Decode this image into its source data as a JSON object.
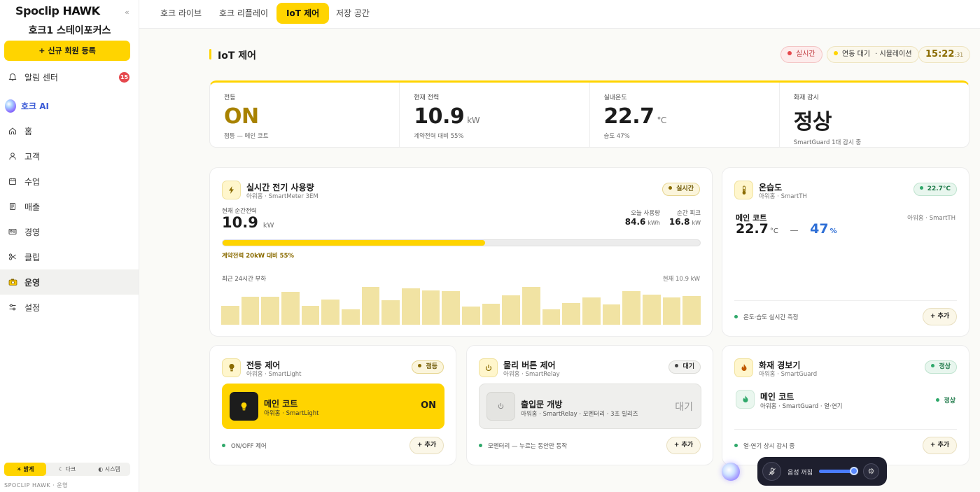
{
  "sidebar": {
    "logo_a": "Spoclip",
    "logo_b": "HAWK",
    "collapse": "«",
    "store": "호크1 스테이포커스",
    "new_member": "+ 신규 회원 등록",
    "items": [
      {
        "label": "알림 센터",
        "icon": "bell-icon",
        "badge": "15"
      },
      {
        "label": "호크 AI",
        "icon": "ai-orb-icon"
      },
      {
        "label": "홈",
        "icon": "home-icon"
      },
      {
        "label": "고객",
        "icon": "person-icon"
      },
      {
        "label": "수업",
        "icon": "calendar-icon"
      },
      {
        "label": "매출",
        "icon": "receipt-icon"
      },
      {
        "label": "경영",
        "icon": "id-card-icon"
      },
      {
        "label": "클립",
        "icon": "scissors-icon"
      },
      {
        "label": "운영",
        "icon": "camera-icon"
      },
      {
        "label": "설정",
        "icon": "sliders-icon"
      }
    ],
    "theme": {
      "light": "☀ 밝게",
      "dark": "☾ 다크",
      "system": "◐ 시스템"
    },
    "footer": "SPOCLIP HAWK · 운영"
  },
  "tabs": [
    "호크 라이브",
    "호크 리플레이",
    "IoT 제어",
    "저장 공간"
  ],
  "page": {
    "title": "IoT 제어",
    "status_live": "실시간",
    "status_sim_a": "연동 대기",
    "status_sim_b": "· 시뮬레이션",
    "clock_main": "15:22",
    "clock_sec": ":31"
  },
  "stats": [
    {
      "label": "전등",
      "value": "ON",
      "unit": "",
      "sub": "점등 — 메인 코트"
    },
    {
      "label": "현재 전력",
      "value": "10.9",
      "unit": "kW",
      "sub": "계약전력 대비 55%"
    },
    {
      "label": "실내온도",
      "value": "22.7",
      "unit": "°C",
      "sub": "습도 47%"
    },
    {
      "label": "화재 감시",
      "value": "정상",
      "unit": "",
      "sub": "SmartGuard 1대 감시 중"
    }
  ],
  "power": {
    "title": "실시간 전기 사용량",
    "sub": "아워홈 · SmartMeter 3EM",
    "badge": "실시간",
    "current_label": "현재 순간전력",
    "current_value": "10.9",
    "current_unit": "kW",
    "today_label": "오늘 사용량",
    "today_value": "84.6",
    "today_unit": "kWh",
    "peak_label": "순간 피크",
    "peak_value": "16.8",
    "peak_unit": "kW",
    "progress": 0.55,
    "progress_label": "계약전력 20kW 대비 55%",
    "chart_label": "최근 24시간 부하",
    "chart_now": "현재 10.9 kW",
    "hourly_load": [
      28,
      41,
      41,
      49,
      28,
      37,
      23,
      56,
      36,
      54,
      51,
      50,
      27,
      31,
      43,
      56,
      23,
      32,
      40,
      30,
      50,
      44,
      40,
      42
    ]
  },
  "climate": {
    "title": "온습도",
    "sub": "아워홈 · SmartTH",
    "badge": "22.7°C",
    "zone": "메인 코트",
    "device": "아워홈 · SmartTH",
    "temp": "22.7",
    "temp_unit": "°C",
    "sep": "—",
    "hum": "47",
    "hum_unit": "%",
    "foot": "온도·습도 실시간 측정",
    "add": "+ 추가"
  },
  "light": {
    "title": "전등 제어",
    "sub": "아워홈 · SmartLight",
    "badge": "점등",
    "zone": "메인 코트",
    "device": "아워홈 · SmartLight",
    "state": "ON",
    "foot": "ON/OFF 제어",
    "add": "+ 추가"
  },
  "relay": {
    "title": "물리 버튼 제어",
    "sub": "아워홈 · SmartRelay",
    "badge": "대기",
    "zone": "출입문 개방",
    "device": "아워홈 · SmartRelay · 모멘터리 · 3초 릴리즈",
    "state": "대기",
    "foot": "모멘터리 — 누르는 동안만 동작",
    "add": "+ 추가"
  },
  "fire": {
    "title": "화재 경보기",
    "sub": "아워홈 · SmartGuard",
    "badge": "정상",
    "zone": "메인 코트",
    "device": "아워홈 · SmartGuard · 열·연기",
    "state": "정상",
    "foot": "열·연기 상시 감시 중",
    "add": "+ 추가"
  },
  "voice": {
    "label": "음성 꺼짐",
    "level": 0.9
  },
  "colors": {
    "accent": "#ffd400",
    "live_red": "#e5484d",
    "ok_green": "#2fa86a",
    "hum_blue": "#2f6fd6"
  }
}
